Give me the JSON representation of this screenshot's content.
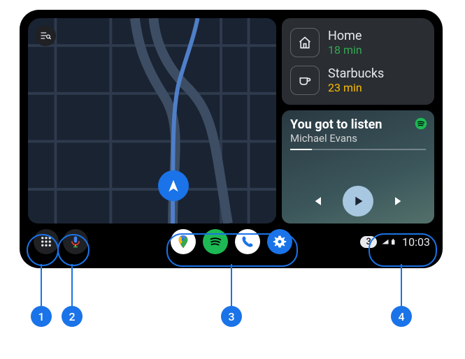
{
  "destinations": [
    {
      "name": "Home",
      "eta": "18 min",
      "icon": "home-icon"
    },
    {
      "name": "Starbucks",
      "eta": "23 min",
      "icon": "cup-icon"
    }
  ],
  "media": {
    "title": "You got to listen",
    "artist": "Michael Evans",
    "progress_percent": 16,
    "provider": "spotify"
  },
  "status": {
    "notification_count": "3",
    "time": "10:03"
  },
  "dock_apps": [
    {
      "name": "google-maps"
    },
    {
      "name": "spotify"
    },
    {
      "name": "phone"
    },
    {
      "name": "settings"
    }
  ],
  "callouts": {
    "c1": "1",
    "c2": "2",
    "c3": "3",
    "c4": "4"
  },
  "colors": {
    "accent": "#1a73e8",
    "eta_near": "#34a853",
    "eta_med": "#fbbc04"
  }
}
